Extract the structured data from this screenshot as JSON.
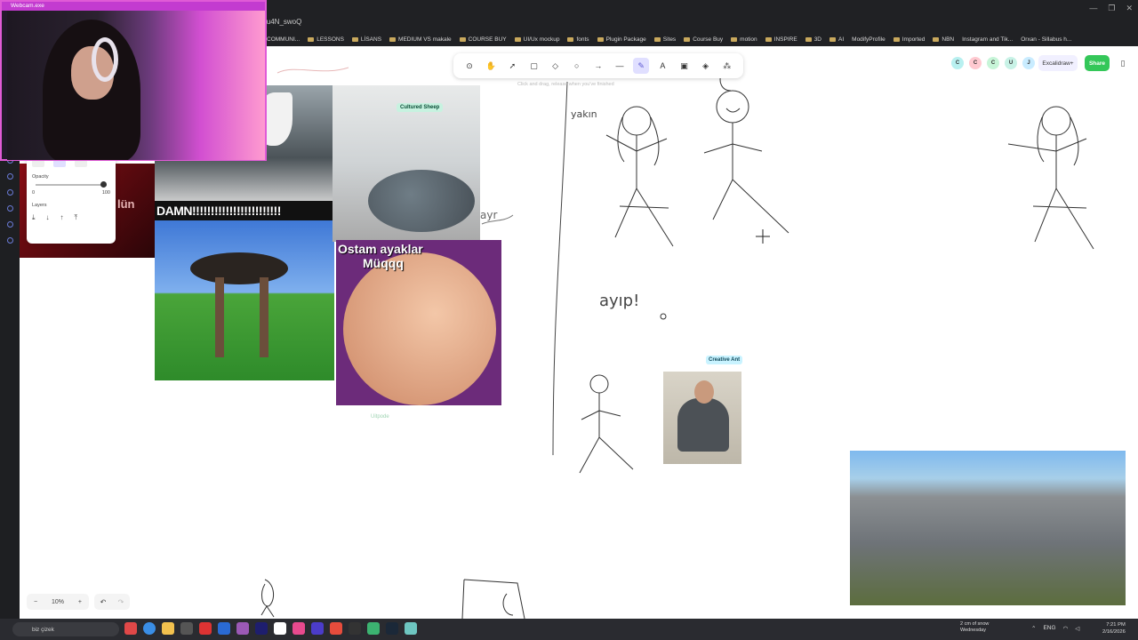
{
  "browser": {
    "tab_title": "iu4N_swoQ",
    "window_controls": [
      "—",
      "❐",
      "✕"
    ],
    "bookmarks": [
      "COMMUNI...",
      "LESSONS",
      "LİSANS",
      "MEDIUM VS makale",
      "COURSE BUY",
      "UI/Ux mockup",
      "fonts",
      "Plugin Package",
      "Sites",
      "Course Buy",
      "motion",
      "INSPIRE",
      "3D",
      "AI",
      "ModifyProfile",
      "Imported",
      "NBN",
      "Instagram and Tik...",
      "Orxan - Sillabus h..."
    ]
  },
  "webcam": {
    "title": "Webcam.exe"
  },
  "excalidraw": {
    "hint": "Click and drag, release when you've finished",
    "collaborators": [
      {
        "initial": "C",
        "color": "#b8f0f0"
      },
      {
        "initial": "C",
        "color": "#ffc9d0"
      },
      {
        "initial": "C",
        "color": "#c7f5d8"
      },
      {
        "initial": "U",
        "color": "#c8f2e6"
      },
      {
        "initial": "J",
        "color": "#c9ecff"
      }
    ],
    "plus_label": "Excalidraw+",
    "share_label": "Share",
    "props": {
      "opacity_label": "Opacity",
      "opacity_min": "0",
      "opacity_max": "100",
      "layers_label": "Layers"
    },
    "zoom": {
      "minus": "−",
      "value": "10%",
      "plus": "+"
    },
    "tools": [
      "lock-icon",
      "hand-icon",
      "selection-icon",
      "rectangle-icon",
      "diamond-icon",
      "ellipse-icon",
      "arrow-icon",
      "line-icon",
      "pencil-icon",
      "text-icon",
      "image-icon",
      "eraser-icon",
      "more-tools-icon"
    ]
  },
  "canvas": {
    "labels": {
      "cultured_sheep": "Cultured Sheep",
      "creative_ant": "Creative Ant",
      "uitpode": "Uitpode",
      "damn_caption": "DAMN!!!!!!!!!!!!!!!!!!!!!!!!",
      "ostam_caption_1": "Ostam ayaklar",
      "ostam_caption_2": "Müqqq",
      "red_text": "lün"
    },
    "handwriting": {
      "ayip": "ayıp!",
      "yakin": "yakın",
      "ayr": "ayr"
    }
  },
  "taskbar": {
    "search_text": "biz çizek",
    "weather_line1": "2 cm of snow",
    "weather_line2": "Wednesday",
    "lang": "ENG",
    "time": "7:21 PM",
    "date": "2/16/2026"
  }
}
